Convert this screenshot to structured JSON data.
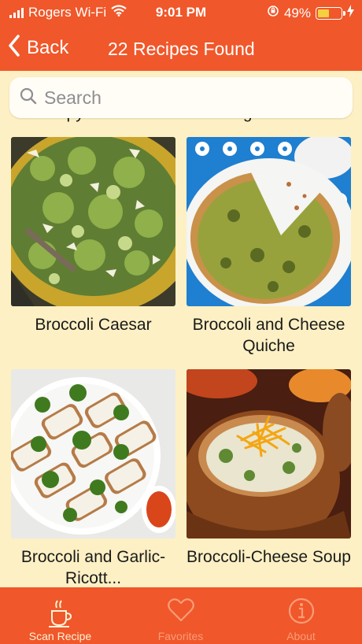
{
  "status_bar": {
    "carrier": "Rogers Wi-Fi",
    "time": "9:01 PM",
    "battery": "49%",
    "battery_level": 0.49
  },
  "nav": {
    "back_label": "Back",
    "title": "22 Recipes Found"
  },
  "search": {
    "placeholder": "Search"
  },
  "previous_row": [
    {
      "name": "Crispy Chees..."
    },
    {
      "name": "Bolognese wit..."
    }
  ],
  "recipes": [
    {
      "name": "Broccoli Caesar",
      "image": "broccoli-caesar-photo"
    },
    {
      "name": "Broccoli and Cheese Quiche",
      "image": "broccoli-quiche-photo"
    },
    {
      "name": "Broccoli and Garlic-Ricott...",
      "image": "broccoli-ricotta-toast-photo"
    },
    {
      "name": "Broccoli-Cheese Soup",
      "image": "broccoli-cheese-soup-photo"
    }
  ],
  "tabs": [
    {
      "label": "Scan Recipe",
      "icon": "scan-recipe-icon",
      "active": true
    },
    {
      "label": "Favorites",
      "icon": "heart-icon",
      "active": false
    },
    {
      "label": "About",
      "icon": "info-icon",
      "active": false
    }
  ],
  "colors": {
    "accent": "#F0572A",
    "background": "#FDF0C4"
  }
}
